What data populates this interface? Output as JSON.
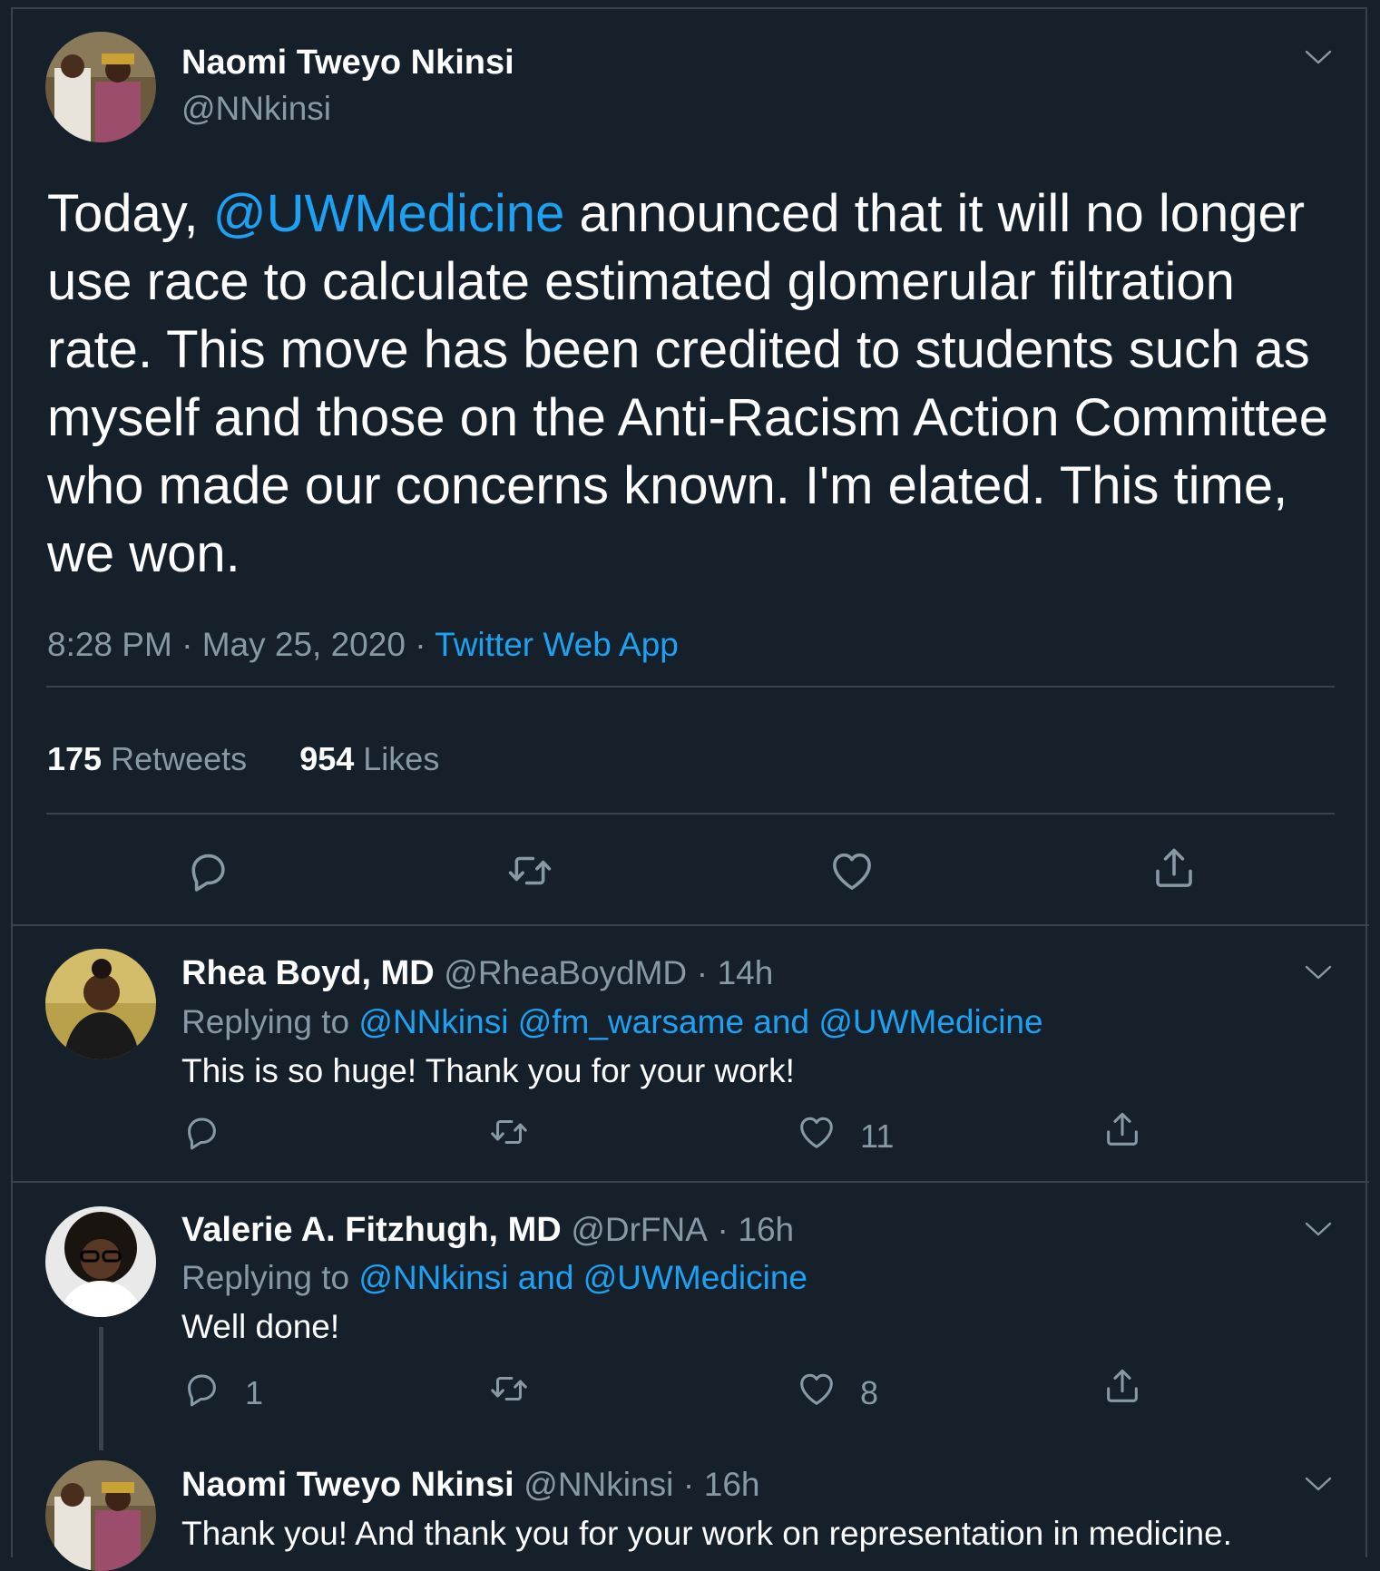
{
  "main_tweet": {
    "author_name": "Naomi Tweyo Nkinsi",
    "author_handle": "@NNkinsi",
    "text_before_mention": "Today, ",
    "mention": "@UWMedicine",
    "text_after_mention": " announced that it will no longer use race to calculate estimated glomerular filtration rate. This move has been credited to students such as myself and those on the Anti-Racism Action Committee who made our concerns known. I'm elated. This time, we won.",
    "time": "8:28 PM",
    "date": "May 25, 2020",
    "separator": "·",
    "source": "Twitter Web App",
    "retweets_count": "175",
    "retweets_label": "Retweets",
    "likes_count": "954",
    "likes_label": "Likes"
  },
  "replies": [
    {
      "author_name": "Rhea Boyd, MD",
      "author_handle": "@RheaBoydMD",
      "time": "14h",
      "replying_label": "Replying to",
      "replying_to": "@NNkinsi @fm_warsame and @UWMedicine",
      "text": "This is so huge! Thank you for your work!",
      "reply_count": "",
      "retweet_count": "",
      "like_count": "11"
    },
    {
      "author_name": "Valerie A. Fitzhugh, MD",
      "author_handle": "@DrFNA",
      "time": "16h",
      "replying_label": "Replying to",
      "replying_to": "@NNkinsi and @UWMedicine",
      "text": "Well done!",
      "reply_count": "1",
      "retweet_count": "",
      "like_count": "8"
    },
    {
      "author_name": "Naomi Tweyo Nkinsi",
      "author_handle": "@NNkinsi",
      "time": "16h",
      "text": "Thank you! And thank you for your work on representation in medicine."
    }
  ],
  "icons": {
    "reply": "reply-icon",
    "retweet": "retweet-icon",
    "like": "heart-icon",
    "share": "share-icon",
    "more": "chevron-down-icon"
  },
  "colors": {
    "background": "#15202b",
    "link": "#1da1f2",
    "muted": "#8899a6",
    "divider": "#38444d"
  }
}
